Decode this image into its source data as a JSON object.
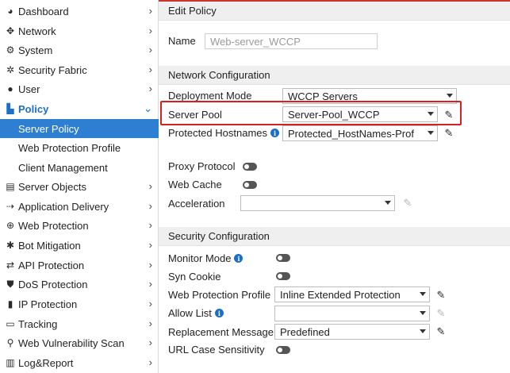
{
  "sidebar": {
    "items": [
      {
        "label": "Dashboard",
        "icon": "dashboard-icon"
      },
      {
        "label": "Network",
        "icon": "network-icon"
      },
      {
        "label": "System",
        "icon": "gear-icon"
      },
      {
        "label": "Security Fabric",
        "icon": "fabric-icon"
      },
      {
        "label": "User",
        "icon": "user-icon"
      },
      {
        "label": "Policy",
        "icon": "policy-icon"
      },
      {
        "label": "Server Objects",
        "icon": "server-icon"
      },
      {
        "label": "Application Delivery",
        "icon": "delivery-icon"
      },
      {
        "label": "Web Protection",
        "icon": "globe-icon"
      },
      {
        "label": "Bot Mitigation",
        "icon": "bot-icon"
      },
      {
        "label": "API Protection",
        "icon": "api-icon"
      },
      {
        "label": "DoS Protection",
        "icon": "shield-icon"
      },
      {
        "label": "IP Protection",
        "icon": "ip-icon"
      },
      {
        "label": "Tracking",
        "icon": "tracking-icon"
      },
      {
        "label": "Web Vulnerability Scan",
        "icon": "scan-icon"
      },
      {
        "label": "Log&Report",
        "icon": "report-icon"
      }
    ],
    "policy_sub": [
      {
        "label": "Server Policy"
      },
      {
        "label": "Web Protection Profile"
      },
      {
        "label": "Client Management"
      }
    ]
  },
  "main": {
    "title": "Edit Policy",
    "name_label": "Name",
    "name_value": "Web-server_WCCP",
    "network_config": {
      "header": "Network Configuration",
      "deployment_mode_label": "Deployment Mode",
      "deployment_mode_value": "WCCP Servers",
      "server_pool_label": "Server Pool",
      "server_pool_value": "Server-Pool_WCCP",
      "protected_hostnames_label": "Protected Hostnames",
      "protected_hostnames_value": "Protected_HostNames-Prof",
      "proxy_protocol_label": "Proxy Protocol",
      "web_cache_label": "Web Cache",
      "acceleration_label": "Acceleration",
      "acceleration_value": ""
    },
    "security_config": {
      "header": "Security Configuration",
      "monitor_mode_label": "Monitor Mode",
      "syn_cookie_label": "Syn Cookie",
      "web_protection_profile_label": "Web Protection Profile",
      "web_protection_profile_value": "Inline Extended Protection",
      "allow_list_label": "Allow List",
      "allow_list_value": "",
      "replacement_message_label": "Replacement Message",
      "replacement_message_value": "Predefined",
      "url_case_sensitivity_label": "URL Case Sensitivity"
    }
  },
  "colors": {
    "accent": "#2e7fd2",
    "highlight_box": "#d62020",
    "top_strip": "#c9342e"
  }
}
